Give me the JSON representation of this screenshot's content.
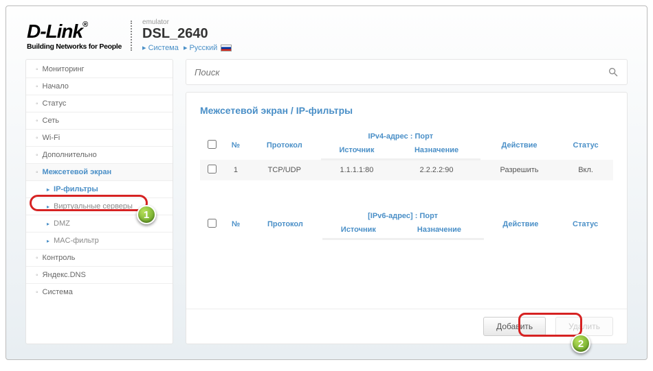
{
  "header": {
    "logo_main": "D-Link",
    "logo_sub": "Building Networks for People",
    "emulator": "emulator",
    "model": "DSL_2640",
    "system": "Система",
    "lang": "Русский"
  },
  "sidebar": {
    "items": [
      {
        "label": "Мониторинг",
        "sub": false
      },
      {
        "label": "Начало",
        "sub": false
      },
      {
        "label": "Статус",
        "sub": false
      },
      {
        "label": "Сеть",
        "sub": false
      },
      {
        "label": "Wi-Fi",
        "sub": false
      },
      {
        "label": "Дополнительно",
        "sub": false
      },
      {
        "label": "Межсетевой экран",
        "sub": false,
        "active": true
      },
      {
        "label": "IP-фильтры",
        "sub": true,
        "selected": true
      },
      {
        "label": "Виртуальные серверы",
        "sub": true
      },
      {
        "label": "DMZ",
        "sub": true
      },
      {
        "label": "MAC-фильтр",
        "sub": true
      },
      {
        "label": "Контроль",
        "sub": false
      },
      {
        "label": "Яндекс.DNS",
        "sub": false
      },
      {
        "label": "Система",
        "sub": false
      }
    ]
  },
  "search": {
    "placeholder": "Поиск"
  },
  "breadcrumb": {
    "parent": "Межсетевой экран",
    "sep": " /  ",
    "current": "IP-фильтры"
  },
  "ipv4": {
    "group_header": "IPv4-адрес : Порт",
    "cols": {
      "num": "№",
      "proto": "Протокол",
      "src": "Источник",
      "dst": "Назначение",
      "action": "Действие",
      "status": "Статус"
    },
    "rows": [
      {
        "num": "1",
        "proto": "TCP/UDP",
        "src": "1.1.1.1:80",
        "dst": "2.2.2.2:90",
        "action": "Разрешить",
        "status": "Вкл."
      }
    ]
  },
  "ipv6": {
    "group_header": "[IPv6-адрес] : Порт",
    "cols": {
      "num": "№",
      "proto": "Протокол",
      "src": "Источник",
      "dst": "Назначение",
      "action": "Действие",
      "status": "Статус"
    }
  },
  "buttons": {
    "add": "Добавить",
    "delete": "Удалить"
  },
  "markers": {
    "one": "1",
    "two": "2"
  }
}
